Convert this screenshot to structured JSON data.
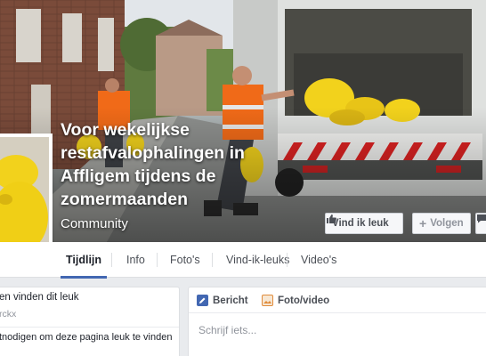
{
  "page": {
    "title": "Voor wekelijkse restafvalophalingen in Affligem tijdens de zomermaanden",
    "category": "Community"
  },
  "cover_buttons": {
    "like": "Vind ik leuk",
    "follow": "Volgen"
  },
  "tabs": [
    {
      "label": "Tijdlijn",
      "active": true
    },
    {
      "label": "Info"
    },
    {
      "label": "Foto's"
    },
    {
      "label": "Vind-ik-leuks"
    },
    {
      "label": "Video's"
    }
  ],
  "left_card": {
    "likes_line": "en vinden dit leuk",
    "likes_name": "rckx",
    "invite_line": "tnodigen om deze pagina leuk te vinden"
  },
  "composer": {
    "tab_post": "Bericht",
    "tab_photo": "Foto/video",
    "placeholder": "Schrijf iets..."
  },
  "colors": {
    "brand_blue": "#4267b2",
    "button_bg": "#f6f7f9",
    "page_bg": "#e9ebee"
  }
}
